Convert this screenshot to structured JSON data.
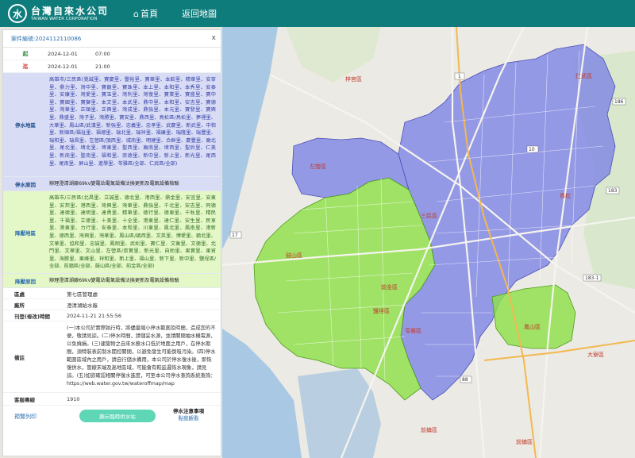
{
  "header": {
    "logo_mark": "水",
    "logo_zh": "台灣自來水公司",
    "logo_en": "TAIWAN WATER CORPORATION",
    "nav_home": "首頁",
    "nav_back": "返回地圖",
    "bar_color": "#0f7c7c"
  },
  "panel": {
    "case_label": "案件編號:",
    "case_value": "2024112110086",
    "close": "x",
    "start_label": "起",
    "start_date": "2024-12-01",
    "start_time": "07:00",
    "end_label": "迄",
    "end_date": "2024-12-01",
    "end_time": "21:00",
    "outage_area_label": "停水地區",
    "outage_area_text": "高雄市/三民區(覺誠里、寶慶里、豐裕里、寶華里、本館里、精華里、安寧里、鼎力里、灣中里、寶龍里、寶珠里、本上里、本和里、本秀里、安泰里、安康里、灣愛里、寶玉里、灣利里、灣復里、寶業里、寶盛里、寶中里、寶國里、寶獅里、本文里、本武里、鼎中里、本和里、安吉里、寶德里、灣華里、正順里、正興里、灣成里、鼎強里、本元里、寶發里、寶興里、鼎盛里、灣子里、灣勝里、寶安里、鼎西里、鳥松區/鳥松里、夢裡里、大華里、鳳山區/武漢里、新強里、忠義里、忠孝里、武慶里、新武里、中和里、新順區/福祉里、福德里、瑞北里、瑞祥里、福康里、瑞隆里、瑞豐里、瑞和里、瑞昌里、左營區/頂西里、城南里、明建里、合群里、慶豐里、廟北里、尾北里、埤北里、埤東里、聖西里、廟南里、埤西里、聖后里、仁美里、新南里、聖南里、福和里、崇德里、新中里、新上里、新光里、尾西里、尾南里、屏山里、進學里、苓雅區/全部、仁武區/全部)",
    "outage_reason_label": "停水原因",
    "outage_reason": "辦理澄清湖廠69kv變電站電氣設備汰換更新及電氣設備檢驗",
    "lowp_area_label": "降壓地區",
    "lowp_area_text": "高雄市/三民區(北昌里、立誠里、德北里、港西里、鼎金里、安宜里、安東里、安邦里、港西里、灣興里、灣華里、鼎強里、千北里、安吉里、同德里、達德里、達明里、達勇里、精華里、德行里、德東里、千秋里、精民里、千福里、立德里、十美里、十全里、港東里、達仁里、安生里、民享里、港東里、力行里、安泰里、本和里、川東里、鳳北里、鳳南里、港新里、德西里、灣興里、灣華里、鳳山區/鎮西里、文英里、博愛里、鎮北里、文華里、協和里、忠誠里、鳳翔里、武松里、寶仁里、文衡里、文德里、北門里、文華里、文山里、左營區/崇實里、新光里、自助里、果實里、果貿里、海勝里、果峰里、祥和里、新上里、福山里、新下里、新中里、鹽埕區/全部、前鎮區/全部、鼓山區/全部、前金區/全部)",
    "lowp_reason_label": "降壓原因",
    "lowp_reason": "辦理澄清湖廠69kv變電站電氣設備汰換更新及電氣設備檢驗",
    "region_label": "區處",
    "region_value": "第七區管理處",
    "office_label": "廠所",
    "office_value": "澄清湖給水廠",
    "pub_label": "刊登(修改)時間",
    "pub_value": "2024-11-21 21:55:56",
    "note_label": "備註",
    "note_text": "(一)本公司於實際執行時，將儘量縮小停水範圍及時間，造成您的不便，敬請見諒。(二)停水時間，請儲妥水源，並請關閉抽水機電源，以免燒損。(三)建築物之自來水應水口低於地面之用戶，在停水期間，須特裝表前制水閥控關閉，以避免發生可能倒吸污染。(四)停水範圍區域內之用戶，請自行儲水備用，本公司於停水復水後，即恢復供水，管線末端及高地區域，可能會有較延遲恢水現象，請見諒。(五)如欲確認相關停復水進度，可至本公司停水查詢系統查詢：https://web.water.gov.tw/wateroffmap/map",
    "phone_label": "客服專線",
    "phone_value": "1910",
    "print_link": "預覽列印",
    "station_button": "顯示臨時供水站",
    "notice_title": "停水注意事項",
    "notice_link": "點我觀看",
    "outage_color": "#d9dcf5",
    "lowp_color": "#e4f7c7"
  },
  "map": {
    "outage_fill": "#7b82e6",
    "lowp_fill": "#8fe04a",
    "districts": [
      "三民區",
      "苓雅區",
      "鳥松區",
      "仁武區",
      "左營區",
      "鼓山區",
      "前金區",
      "鹽埕區",
      "鳳山區",
      "前鎮區",
      "大寮區",
      "梓官區",
      "鳥松",
      "橋頭區"
    ],
    "routes": [
      "1",
      "17",
      "10",
      "186",
      "183",
      "183-1",
      "88"
    ]
  }
}
